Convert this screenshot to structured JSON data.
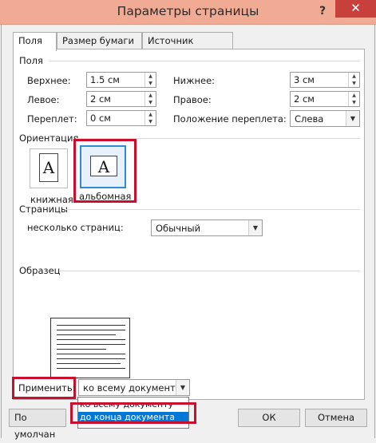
{
  "window": {
    "title": "Параметры страницы",
    "help_label": "?",
    "close_label": "✕"
  },
  "tabs": [
    {
      "label": "Поля",
      "active": true
    },
    {
      "label": "Размер бумаги",
      "active": false
    },
    {
      "label": "Источник бумаги",
      "active": false
    }
  ],
  "margins": {
    "section_label": "Поля",
    "top_label": "Верхнее:",
    "top_value": "1.5 см",
    "bottom_label": "Нижнее:",
    "bottom_value": "3 см",
    "left_label": "Левое:",
    "left_value": "2 см",
    "right_label": "Правое:",
    "right_value": "2 см",
    "gutter_label": "Переплет:",
    "gutter_value": "0 см",
    "gutter_pos_label": "Положение переплета:",
    "gutter_pos_value": "Слева"
  },
  "orientation": {
    "section_label": "Ориентация",
    "portrait_label": "книжная",
    "landscape_label": "альбомная",
    "glyph": "A",
    "selected": "landscape"
  },
  "pages": {
    "section_label": "Страницы",
    "multiple_label": "несколько страниц:",
    "multiple_value": "Обычный"
  },
  "sample": {
    "section_label": "Образец"
  },
  "apply": {
    "label": "Применить:",
    "value": "ко всему документу",
    "options": [
      "ко всему документу",
      "до конца документа"
    ],
    "highlighted_option": "до конца документа"
  },
  "buttons": {
    "default_label": "По умолчан",
    "ok_label": "ОК",
    "cancel_label": "Отмена"
  },
  "colors": {
    "titlebar": "#f1ab94",
    "close": "#c7403c",
    "highlight_box": "#c8102e",
    "selection": "#0078d7"
  }
}
